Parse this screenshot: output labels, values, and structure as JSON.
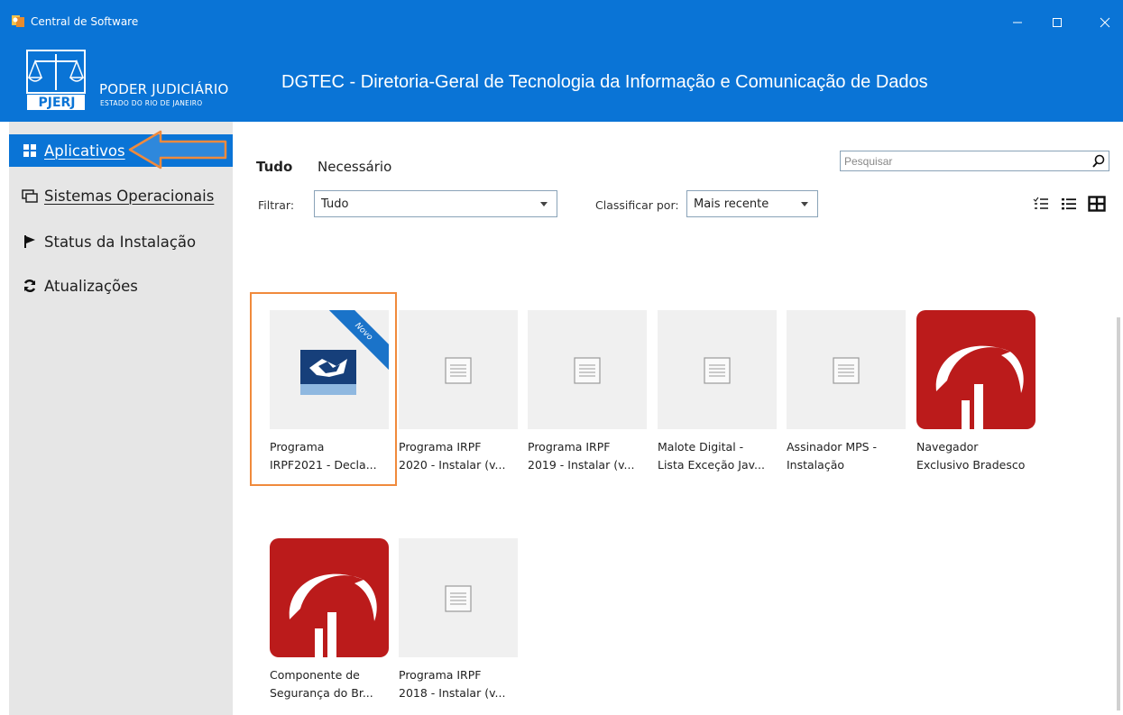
{
  "window": {
    "title": "Central de Software",
    "minimize": "—",
    "maximize": "☐",
    "close": "✕"
  },
  "header": {
    "logo_title": "PODER JUDICIÁRIO",
    "logo_subtitle": "ESTADO DO RIO DE JANEIRO",
    "logo_mark": "PJERJ",
    "org_title": "DGTEC - Diretoria-Geral de Tecnologia da Informação e Comunicação de Dados"
  },
  "sidebar": {
    "items": [
      {
        "label": "Aplicativos",
        "icon": "apps-grid-icon",
        "active": true
      },
      {
        "label": "Sistemas Operacionais",
        "icon": "windows-stack-icon",
        "active": false
      },
      {
        "label": "Status da Instalação",
        "icon": "flag-icon",
        "active": false
      },
      {
        "label": "Atualizações",
        "icon": "refresh-icon",
        "active": false
      }
    ]
  },
  "tabs": [
    {
      "label": "Tudo",
      "active": true
    },
    {
      "label": "Necessário",
      "active": false
    }
  ],
  "search": {
    "placeholder": "Pesquisar"
  },
  "filter": {
    "label": "Filtrar:",
    "value": "Tudo"
  },
  "sort": {
    "label": "Classificar por:",
    "value": "Mais recente"
  },
  "view_modes": [
    "checklist-view-icon",
    "list-view-icon",
    "tile-view-icon"
  ],
  "badge": {
    "new": "Novo"
  },
  "apps": [
    {
      "line1": "Programa",
      "line2": "IRPF2021 - Decla...",
      "thumb": "receita-federal-icon",
      "is_new": true,
      "selected": true
    },
    {
      "line1": "Programa IRPF",
      "line2": "2020 - Instalar (v...",
      "thumb": "generic-app-icon"
    },
    {
      "line1": "Programa IRPF",
      "line2": "2019 - Instalar (v...",
      "thumb": "generic-app-icon"
    },
    {
      "line1": "Malote Digital -",
      "line2": "Lista Exceção Jav...",
      "thumb": "generic-app-icon"
    },
    {
      "line1": "Assinador MPS -",
      "line2": "Instalação",
      "thumb": "generic-app-icon"
    },
    {
      "line1": "Navegador",
      "line2": "Exclusivo Bradesco",
      "thumb": "bradesco-logo-icon"
    },
    {
      "line1": "Componente de",
      "line2": "Segurança do Br...",
      "thumb": "bradesco-logo-icon"
    },
    {
      "line1": "Programa IRPF",
      "line2": "2018 - Instalar (v...",
      "thumb": "generic-app-icon"
    }
  ],
  "colors": {
    "accent": "#0a74d6",
    "sidebar_bg": "#e6e6e6",
    "annotation": "#f08a3c",
    "bradesco_red": "#bb1b1b"
  }
}
